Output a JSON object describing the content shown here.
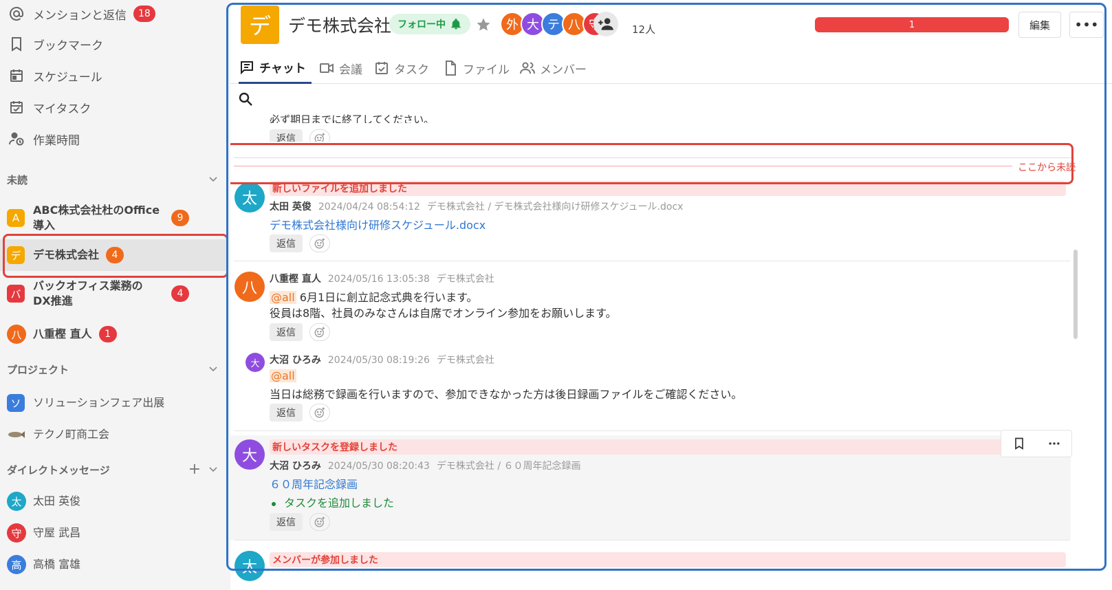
{
  "sidebar": {
    "nav": [
      {
        "label": "メンションと返信",
        "badge": "18",
        "icon": "at-icon"
      },
      {
        "label": "ブックマーク",
        "icon": "bookmark-icon"
      },
      {
        "label": "スケジュール",
        "icon": "calendar-icon"
      },
      {
        "label": "マイタスク",
        "icon": "task-check-icon"
      },
      {
        "label": "作業時間",
        "icon": "user-clock-icon"
      }
    ],
    "sections": {
      "unread": "未読",
      "project": "プロジェクト",
      "dm": "ダイレクトメッセージ",
      "dm_add": "+"
    },
    "unread_channels": [
      {
        "label": "ABC株式会社杜のOffice導入",
        "letter": "A",
        "badge": "9",
        "color": "#f5a800"
      },
      {
        "label": "デモ株式会社",
        "letter": "デ",
        "badge": "4",
        "color": "#f5a800"
      },
      {
        "label": "バックオフィス業務のDX推進",
        "letter": "バ",
        "badge": "4",
        "color": "#e5393f"
      },
      {
        "label": "八重樫 直人",
        "letter": "八",
        "badge": "1",
        "color": "#f06a1b"
      }
    ],
    "projects": [
      {
        "label": "ソリューションフェア出展",
        "letter": "ソ",
        "color": "#3b7ddd"
      },
      {
        "label": "テクノ町商工会",
        "icon": "fish-icon"
      }
    ],
    "dms": [
      {
        "label": "太田 英俊",
        "letter": "太",
        "color": "#1ea7c7"
      },
      {
        "label": "守屋 武昌",
        "letter": "守",
        "color": "#e5393f"
      },
      {
        "label": "高橋 富雄",
        "letter": "高",
        "color": "#3b7ddd"
      }
    ]
  },
  "header": {
    "logo_letter": "デ",
    "title": "デモ株式会社",
    "follow_label": "フォロー中",
    "avatars": [
      {
        "letter": "外",
        "color": "#f06a1b"
      },
      {
        "letter": "大",
        "color": "#8f4de0"
      },
      {
        "letter": "テ",
        "color": "#3b7ddd"
      },
      {
        "letter": "八",
        "color": "#f06a1b"
      },
      {
        "letter": "守",
        "color": "#e5393f"
      }
    ],
    "member_count": "12人",
    "red_bar_count": "1",
    "edit_label": "編集",
    "more_label": "•••"
  },
  "tabs": [
    {
      "label": "チャット",
      "icon": "chat-icon"
    },
    {
      "label": "会議",
      "icon": "video-icon"
    },
    {
      "label": "タスク",
      "icon": "task-icon"
    },
    {
      "label": "ファイル",
      "icon": "file-icon"
    },
    {
      "label": "メンバー",
      "icon": "members-icon"
    }
  ],
  "messages": {
    "partial_text": "必ず期日までに終了してください。",
    "reply_label": "返信",
    "unread_divider": "ここから未読",
    "items": [
      {
        "avatar": "太",
        "color": "#1ea7c7",
        "banner": "新しいファイルを追加しました",
        "author": "太田 英俊",
        "time": "2024/04/24 08:54:12",
        "location": "デモ株式会社 / デモ株式会社様向け研修スケジュール.docx",
        "link": "デモ株式会社様向け研修スケジュール.docx"
      },
      {
        "avatar": "八",
        "color": "#f06a1b",
        "author": "八重樫 直人",
        "time": "2024/05/16 13:05:38",
        "location": "デモ株式会社",
        "mention": "@all",
        "line1": "6月1日に創立記念式典を行います。",
        "line2": "役員は8階、社員のみなさんは自席でオンライン参加をお願いします。"
      },
      {
        "avatar": "大",
        "color": "#8f4de0",
        "author": "大沼 ひろみ",
        "time": "2024/05/30 08:19:26",
        "location": "デモ株式会社",
        "mention": "@all",
        "line1": "当日は総務で録画を行いますので、参加できなかった方は後日録画ファイルをご確認ください。"
      },
      {
        "avatar": "大",
        "color": "#8f4de0",
        "banner": "新しいタスクを登録しました",
        "author": "大沼 ひろみ",
        "time": "2024/05/30 08:20:43",
        "location": "デモ株式会社 / ６０周年記念録画",
        "link": "６０周年記念録画",
        "bullet": "タスクを追加しました"
      },
      {
        "avatar": "太",
        "color": "#1ea7c7",
        "banner": "メンバーが参加しました"
      }
    ]
  }
}
